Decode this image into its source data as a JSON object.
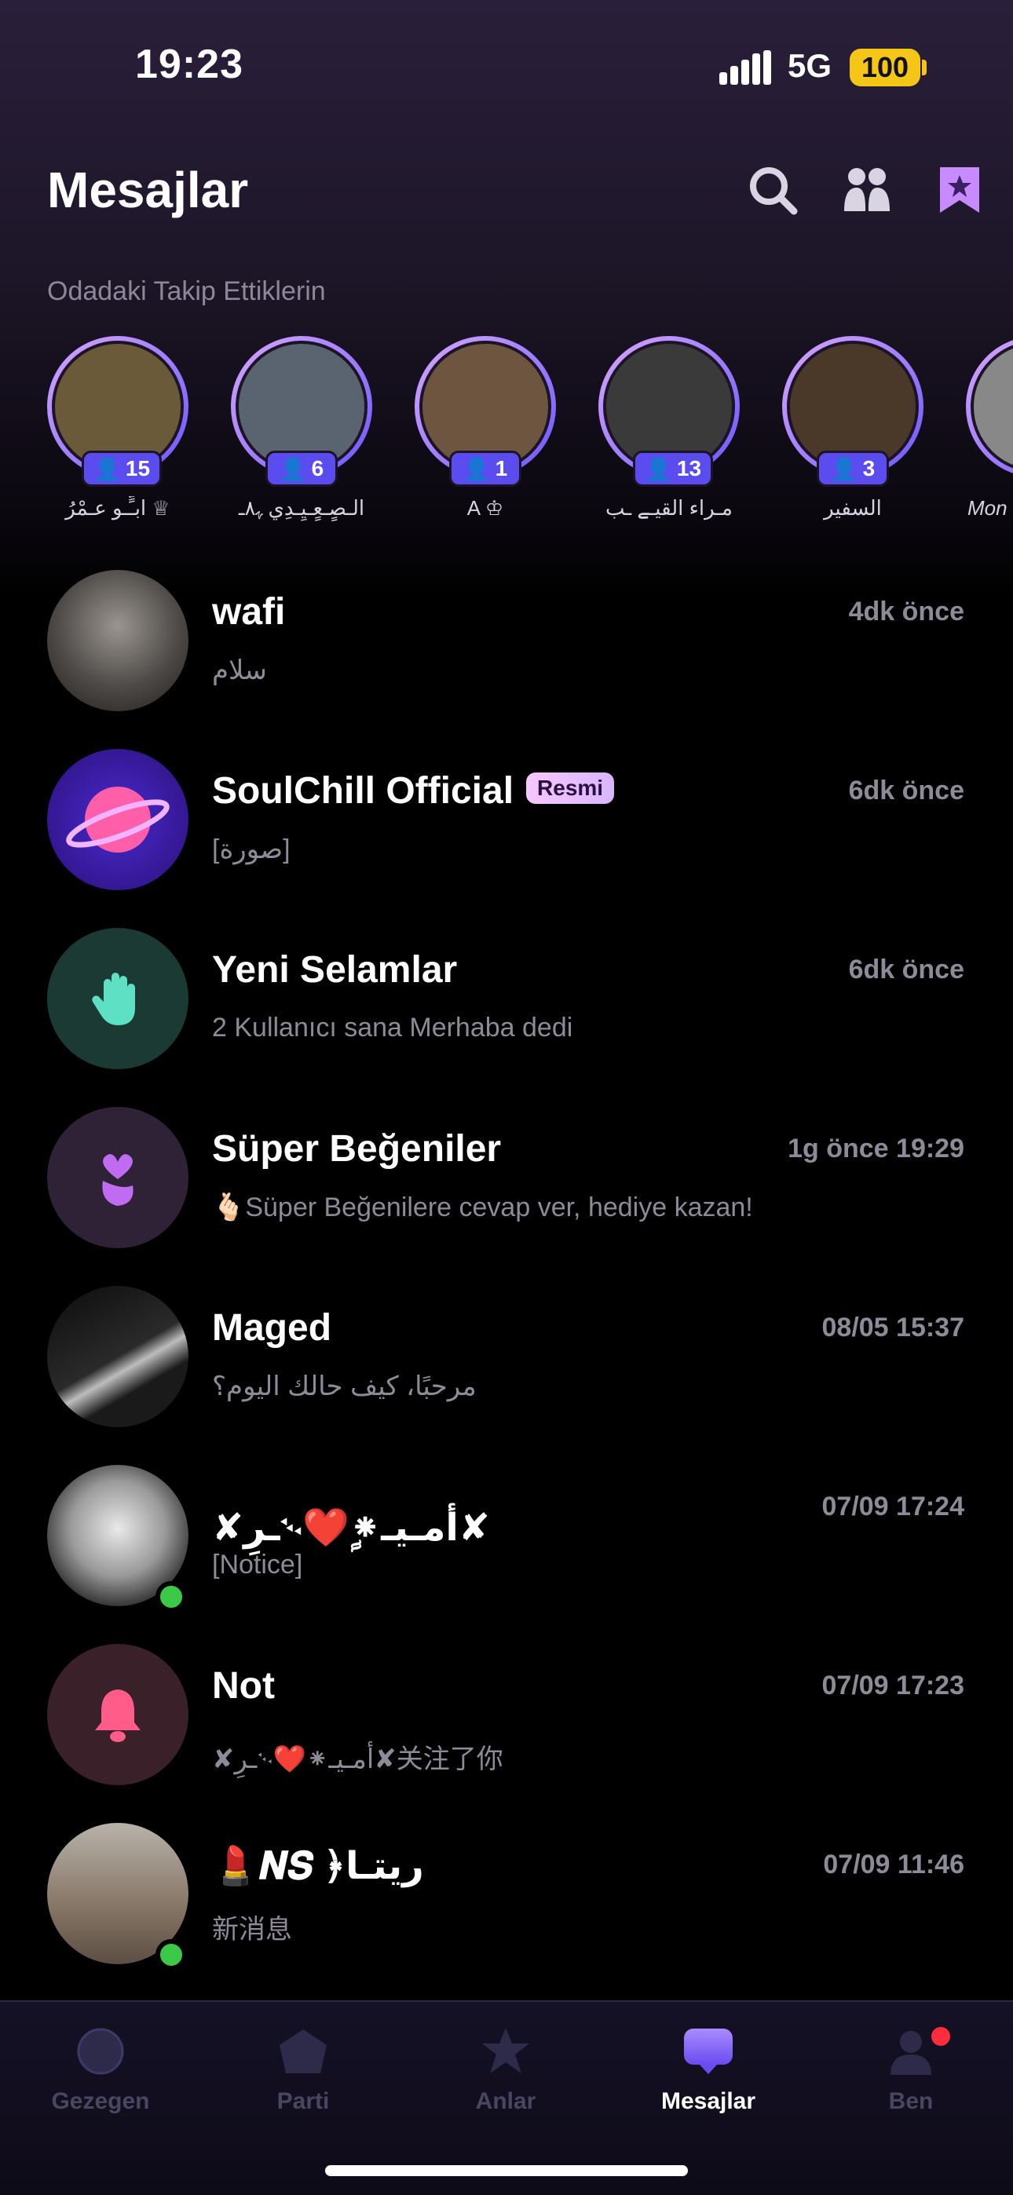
{
  "status_bar": {
    "time": "19:23",
    "network": "5G",
    "battery": "100"
  },
  "header": {
    "title": "Mesajlar",
    "section_label": "Odadaki Takip Ettiklerin"
  },
  "stories": [
    {
      "count": "15",
      "name": "ابـٍّـو عـمْرُ ♕",
      "color": "#6b5a3a"
    },
    {
      "count": "6",
      "name": "الـصٍـعٍـيٍـدِي ﮩ٨ـ",
      "color": "#5a6470"
    },
    {
      "count": "1",
      "name": "A ♔",
      "color": "#6d5540"
    },
    {
      "count": "13",
      "name": "مـراء القيـے ـب",
      "color": "#3a3a3a"
    },
    {
      "count": "3",
      "name": "السفير",
      "color": "#4a3828"
    },
    {
      "count": "",
      "name": "Mon",
      "color": "#888888"
    }
  ],
  "conversations": [
    {
      "title": "wafi",
      "time": "4dk önce",
      "preview": "سلام",
      "avatar_color": "#5c5a58",
      "online": false,
      "badge": ""
    },
    {
      "title": "SoulChill Official",
      "time": "6dk önce",
      "preview": "[صورة]",
      "avatar_color": "#3b1fa6",
      "online": false,
      "badge": "Resmi"
    },
    {
      "title": "Yeni Selamlar",
      "time": "6dk önce",
      "preview": "2 Kullanıcı sana Merhaba dedi",
      "avatar_color": "#1c3a34",
      "online": false,
      "badge": ""
    },
    {
      "title": "Süper Beğeniler",
      "time": "1g önce 19:29",
      "preview": "🫰🏻Süper Beğenilere cevap ver, hediye kazan!",
      "avatar_color": "#2f2236",
      "online": false,
      "badge": ""
    },
    {
      "title": "Maged",
      "time": "08/05 15:37",
      "preview": "مرحبًا، كيف حالك اليوم؟",
      "avatar_color": "#2a2a2a",
      "online": false,
      "badge": ""
    },
    {
      "title": "✘ـرِ࿙❤️ࣩ⁕أمـيـ✘",
      "time": "07/09 17:24",
      "preview": "[Notice]",
      "avatar_color": "#d8d8d8",
      "online": true,
      "badge": ""
    },
    {
      "title": "Not",
      "time": "07/09 17:23",
      "preview": "✘ـرِ࿙❤️⁕أمـيـ✘关注了你",
      "avatar_color": "#3a2028",
      "online": false,
      "badge": ""
    },
    {
      "title": "💄𝑵𝑺 ﴿ريتـا",
      "time": "07/09 11:46",
      "preview": "新消息",
      "avatar_color": "#8a7a6a",
      "online": true,
      "badge": ""
    }
  ],
  "tabs": [
    {
      "label": "Gezegen",
      "icon": "planet-icon",
      "active": false
    },
    {
      "label": "Parti",
      "icon": "party-house-icon",
      "active": false
    },
    {
      "label": "Anlar",
      "icon": "moments-star-icon",
      "active": false
    },
    {
      "label": "Mesajlar",
      "icon": "chat-bubble-icon",
      "active": true
    },
    {
      "label": "Ben",
      "icon": "profile-icon",
      "active": false
    }
  ],
  "colors": {
    "accent": "#5b4cf0",
    "official_badge": "#f6c7ff",
    "online": "#3cc94a",
    "notification_dot": "#ff2d3b"
  }
}
